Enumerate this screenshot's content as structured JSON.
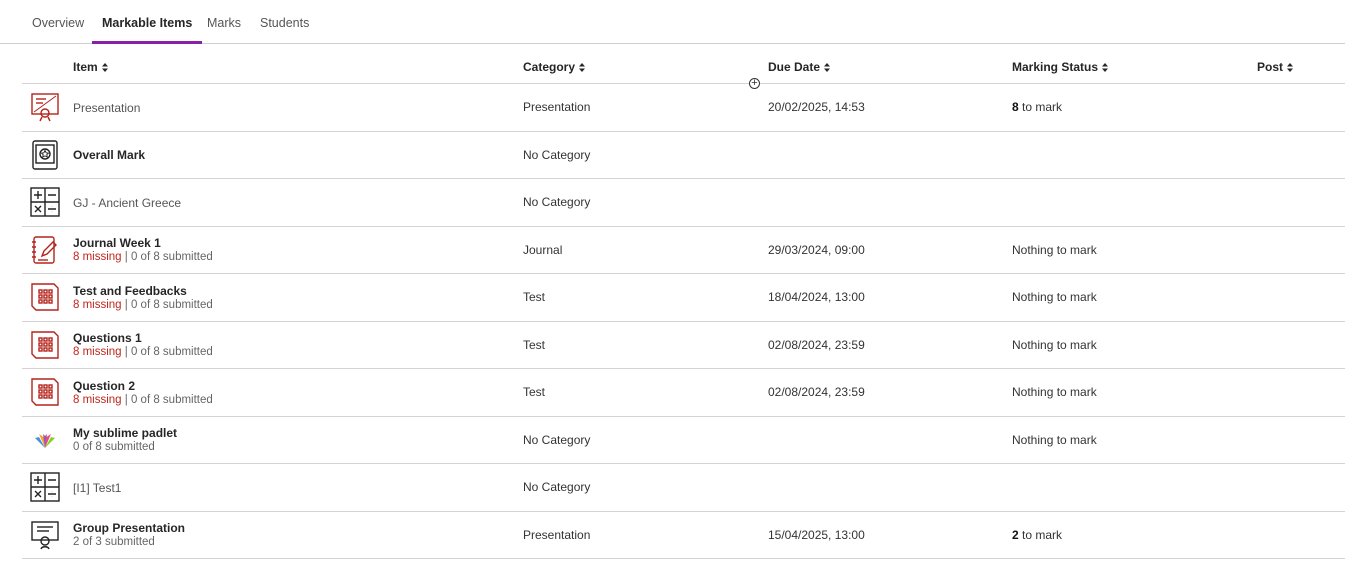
{
  "tabs": [
    {
      "label": "Overview",
      "active": false
    },
    {
      "label": "Markable Items",
      "active": true
    },
    {
      "label": "Marks",
      "active": false
    },
    {
      "label": "Students",
      "active": false
    }
  ],
  "columns": {
    "item": "Item",
    "category": "Category",
    "due_date": "Due Date",
    "marking_status": "Marking Status",
    "post": "Post"
  },
  "add_column_icon": "+",
  "rows": [
    {
      "icon": "presentation-icon",
      "name": "Presentation",
      "name_style": "plain",
      "missing": "",
      "submitted": "",
      "category": "Presentation",
      "due": "20/02/2025, 14:53",
      "status_count": "8",
      "status_text": " to mark"
    },
    {
      "icon": "overall-mark-icon",
      "name": "Overall Mark",
      "name_style": "bold",
      "missing": "",
      "submitted": "",
      "category": "No Category",
      "due": "",
      "status_count": "",
      "status_text": ""
    },
    {
      "icon": "calculation-icon",
      "name": "GJ - Ancient Greece",
      "name_style": "plain",
      "missing": "",
      "submitted": "",
      "category": "No Category",
      "due": "",
      "status_count": "",
      "status_text": ""
    },
    {
      "icon": "journal-icon",
      "name": "Journal Week 1",
      "name_style": "bold",
      "missing": "8 missing",
      "submitted": " | 0 of 8 submitted",
      "category": "Journal",
      "due": "29/03/2024, 09:00",
      "status_count": "",
      "status_text": "Nothing to mark"
    },
    {
      "icon": "test-icon",
      "name": "Test and Feedbacks",
      "name_style": "bold",
      "missing": "8 missing",
      "submitted": " | 0 of 8 submitted",
      "category": "Test",
      "due": "18/04/2024, 13:00",
      "status_count": "",
      "status_text": "Nothing to mark"
    },
    {
      "icon": "test-icon",
      "name": "Questions 1",
      "name_style": "bold",
      "missing": "8 missing",
      "submitted": " | 0 of 8 submitted",
      "category": "Test",
      "due": "02/08/2024, 23:59",
      "status_count": "",
      "status_text": "Nothing to mark"
    },
    {
      "icon": "test-icon",
      "name": "Question 2",
      "name_style": "bold",
      "missing": "8 missing",
      "submitted": " | 0 of 8 submitted",
      "category": "Test",
      "due": "02/08/2024, 23:59",
      "status_count": "",
      "status_text": "Nothing to mark"
    },
    {
      "icon": "padlet-icon",
      "name": "My sublime padlet",
      "name_style": "bold",
      "missing": "",
      "submitted": "0 of 8 submitted",
      "category": "No Category",
      "due": "",
      "status_count": "",
      "status_text": "Nothing to mark"
    },
    {
      "icon": "calculation-icon",
      "name": "[I1] Test1",
      "name_style": "plain",
      "missing": "",
      "submitted": "",
      "category": "No Category",
      "due": "",
      "status_count": "",
      "status_text": ""
    },
    {
      "icon": "group-presentation-icon",
      "name": "Group Presentation",
      "name_style": "bold",
      "missing": "",
      "submitted": "2 of 3 submitted",
      "category": "Presentation",
      "due": "15/04/2025, 13:00",
      "status_count": "2",
      "status_text": " to mark"
    }
  ],
  "colors": {
    "accent": "#8a1fa8",
    "missing": "#c0261c",
    "icon_red": "#b3231b"
  }
}
